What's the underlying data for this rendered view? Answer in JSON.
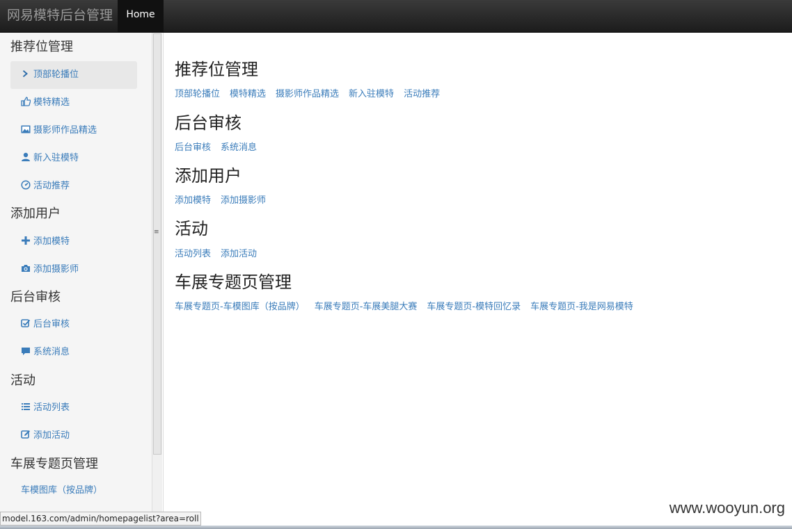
{
  "header": {
    "brand": "网易模特后台管理",
    "home_tab": "Home"
  },
  "sidebar": {
    "sections": [
      {
        "title": "推荐位管理",
        "items": [
          {
            "label": "顶部轮播位",
            "icon": "chevron-right-icon",
            "active": true
          },
          {
            "label": "模特精选",
            "icon": "thumbs-up-icon"
          },
          {
            "label": "摄影师作品精选",
            "icon": "picture-icon"
          },
          {
            "label": "新入驻模特",
            "icon": "user-icon"
          },
          {
            "label": "活动推荐",
            "icon": "dashboard-icon"
          }
        ]
      },
      {
        "title": "添加用户",
        "items": [
          {
            "label": "添加模特",
            "icon": "plus-icon"
          },
          {
            "label": "添加摄影师",
            "icon": "camera-icon"
          }
        ]
      },
      {
        "title": "后台审核",
        "items": [
          {
            "label": "后台审核",
            "icon": "check-icon"
          },
          {
            "label": "系统消息",
            "icon": "comment-icon"
          }
        ]
      },
      {
        "title": "活动",
        "items": [
          {
            "label": "活动列表",
            "icon": "list-icon"
          },
          {
            "label": "添加活动",
            "icon": "edit-icon"
          }
        ]
      },
      {
        "title": "车展专题页管理",
        "items": [
          {
            "label": "车模图库（按品牌）",
            "icon": ""
          }
        ]
      }
    ]
  },
  "main": {
    "sections": [
      {
        "title": "推荐位管理",
        "links": [
          "顶部轮播位",
          "模特精选",
          "摄影师作品精选",
          "新入驻模特",
          "活动推荐"
        ]
      },
      {
        "title": "后台审核",
        "links": [
          "后台审核",
          "系统消息"
        ]
      },
      {
        "title": "添加用户",
        "links": [
          "添加模特",
          "添加摄影师"
        ]
      },
      {
        "title": "活动",
        "links": [
          "活动列表",
          "添加活动"
        ]
      },
      {
        "title": "车展专题页管理",
        "links": [
          "车展专题页-车模图库（按品牌）",
          "车展专题页-车展美腿大赛",
          "车展专题页-模特回忆录",
          "车展专题页-我是网易模特"
        ]
      }
    ]
  },
  "status_url": "model.163.com/admin/homepagelist?area=roll",
  "watermark": "www.wooyun.org",
  "colors": {
    "link": "#3a7cba",
    "navbar": "#222222",
    "sidebar_bg": "#f5f5f5"
  }
}
